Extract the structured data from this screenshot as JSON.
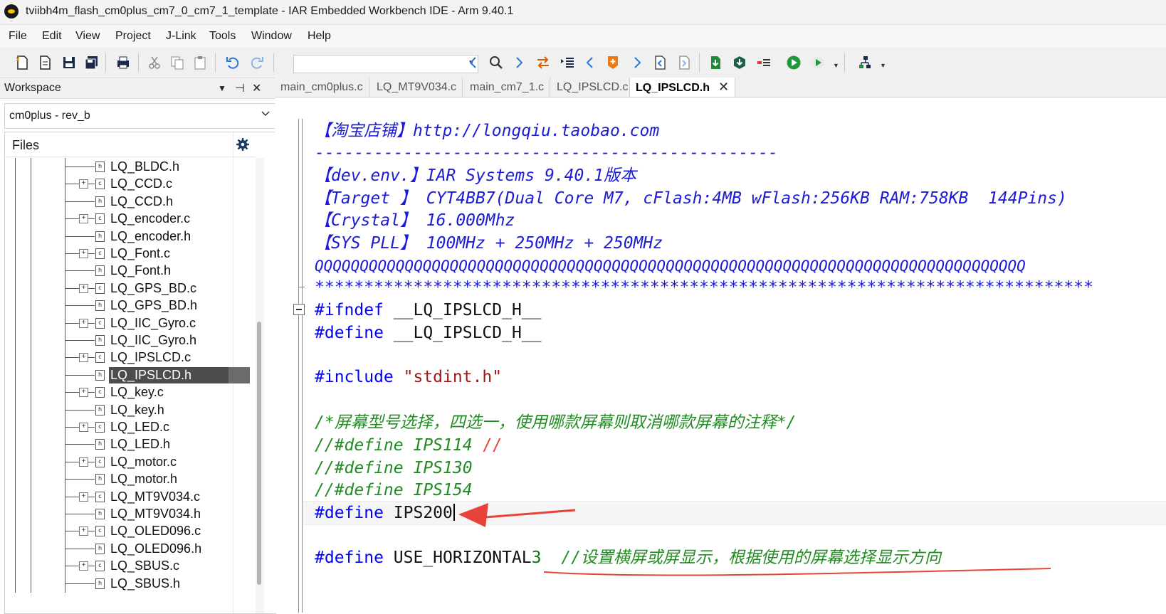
{
  "window": {
    "title": "tviibh4m_flash_cm0plus_cm7_0_cm7_1_template - IAR Embedded Workbench IDE - Arm 9.40.1"
  },
  "menu": [
    "File",
    "Edit",
    "View",
    "Project",
    "J-Link",
    "Tools",
    "Window",
    "Help"
  ],
  "workspace": {
    "title": "Workspace",
    "config": "cm0plus - rev_b",
    "files_label": "Files",
    "files": [
      {
        "name": "LQ_BLDC.h",
        "type": "h"
      },
      {
        "name": "LQ_CCD.c",
        "type": "c"
      },
      {
        "name": "LQ_CCD.h",
        "type": "h"
      },
      {
        "name": "LQ_encoder.c",
        "type": "c"
      },
      {
        "name": "LQ_encoder.h",
        "type": "h"
      },
      {
        "name": "LQ_Font.c",
        "type": "c"
      },
      {
        "name": "LQ_Font.h",
        "type": "h"
      },
      {
        "name": "LQ_GPS_BD.c",
        "type": "c"
      },
      {
        "name": "LQ_GPS_BD.h",
        "type": "h"
      },
      {
        "name": "LQ_IIC_Gyro.c",
        "type": "c"
      },
      {
        "name": "LQ_IIC_Gyro.h",
        "type": "h"
      },
      {
        "name": "LQ_IPSLCD.c",
        "type": "c"
      },
      {
        "name": "LQ_IPSLCD.h",
        "type": "h",
        "selected": true
      },
      {
        "name": "LQ_key.c",
        "type": "c"
      },
      {
        "name": "LQ_key.h",
        "type": "h"
      },
      {
        "name": "LQ_LED.c",
        "type": "c"
      },
      {
        "name": "LQ_LED.h",
        "type": "h"
      },
      {
        "name": "LQ_motor.c",
        "type": "c"
      },
      {
        "name": "LQ_motor.h",
        "type": "h"
      },
      {
        "name": "LQ_MT9V034.c",
        "type": "c"
      },
      {
        "name": "LQ_MT9V034.h",
        "type": "h"
      },
      {
        "name": "LQ_OLED096.c",
        "type": "c"
      },
      {
        "name": "LQ_OLED096.h",
        "type": "h"
      },
      {
        "name": "LQ_SBUS.c",
        "type": "c"
      },
      {
        "name": "LQ_SBUS.h",
        "type": "h"
      }
    ]
  },
  "tabs": [
    {
      "label": "main_cm0plus.c"
    },
    {
      "label": "LQ_MT9V034.c"
    },
    {
      "label": "main_cm7_1.c"
    },
    {
      "label": "LQ_IPSLCD.c"
    },
    {
      "label": "LQ_IPSLCD.h",
      "active": true
    }
  ],
  "code": {
    "l1": "【淘宝店铺】http://longqiu.taobao.com",
    "l2": "-----------------------------------------------",
    "l3": "【dev.env.】IAR Systems 9.40.1版本",
    "l4": "【Target 】 CYT4BB7(Dual Core M7, cFlash:4MB wFlash:256KB RAM:758KB  144Pins)",
    "l5": "【Crystal】 16.000Mhz",
    "l6": "【SYS PLL】 100MHz + 250MHz + 250MHz",
    "l7": "QQQQQQQQQQQQQQQQQQQQQQQQQQQQQQQQQQQQQQQQQQQQQQQQQQQQQQQQQQQQQQQQQQQQQQQQQQQQQQQ",
    "l8": "*******************************************************************************",
    "ifndef_kw": "#ifndef",
    "ifndef_arg": "__LQ_IPSLCD_H__",
    "define_kw": "#define",
    "define_arg": "__LQ_IPSLCD_H__",
    "include_kw": "#include",
    "include_arg": "\"stdint.h\"",
    "comment_select": "/*屏幕型号选择，四选一，使用哪款屏幕则取消哪款屏幕的注释*/",
    "c_ips114": "//#define IPS114",
    "c_ips130": "//#define IPS130",
    "c_ips154": "//#define IPS154",
    "ips200_kw": "#define",
    "ips200_arg": "IPS200",
    "horiz_kw": "#define",
    "horiz_name": "USE_HORIZONTAL",
    "horiz_val": "3",
    "horiz_comment": "//设置横屏或屏显示，根据使用的屏幕选择显示方向"
  },
  "colors": {
    "annotation": "#e8433a",
    "keyword": "#0000ff",
    "comment": "#218c21",
    "header_comment": "#1c1cd4"
  }
}
